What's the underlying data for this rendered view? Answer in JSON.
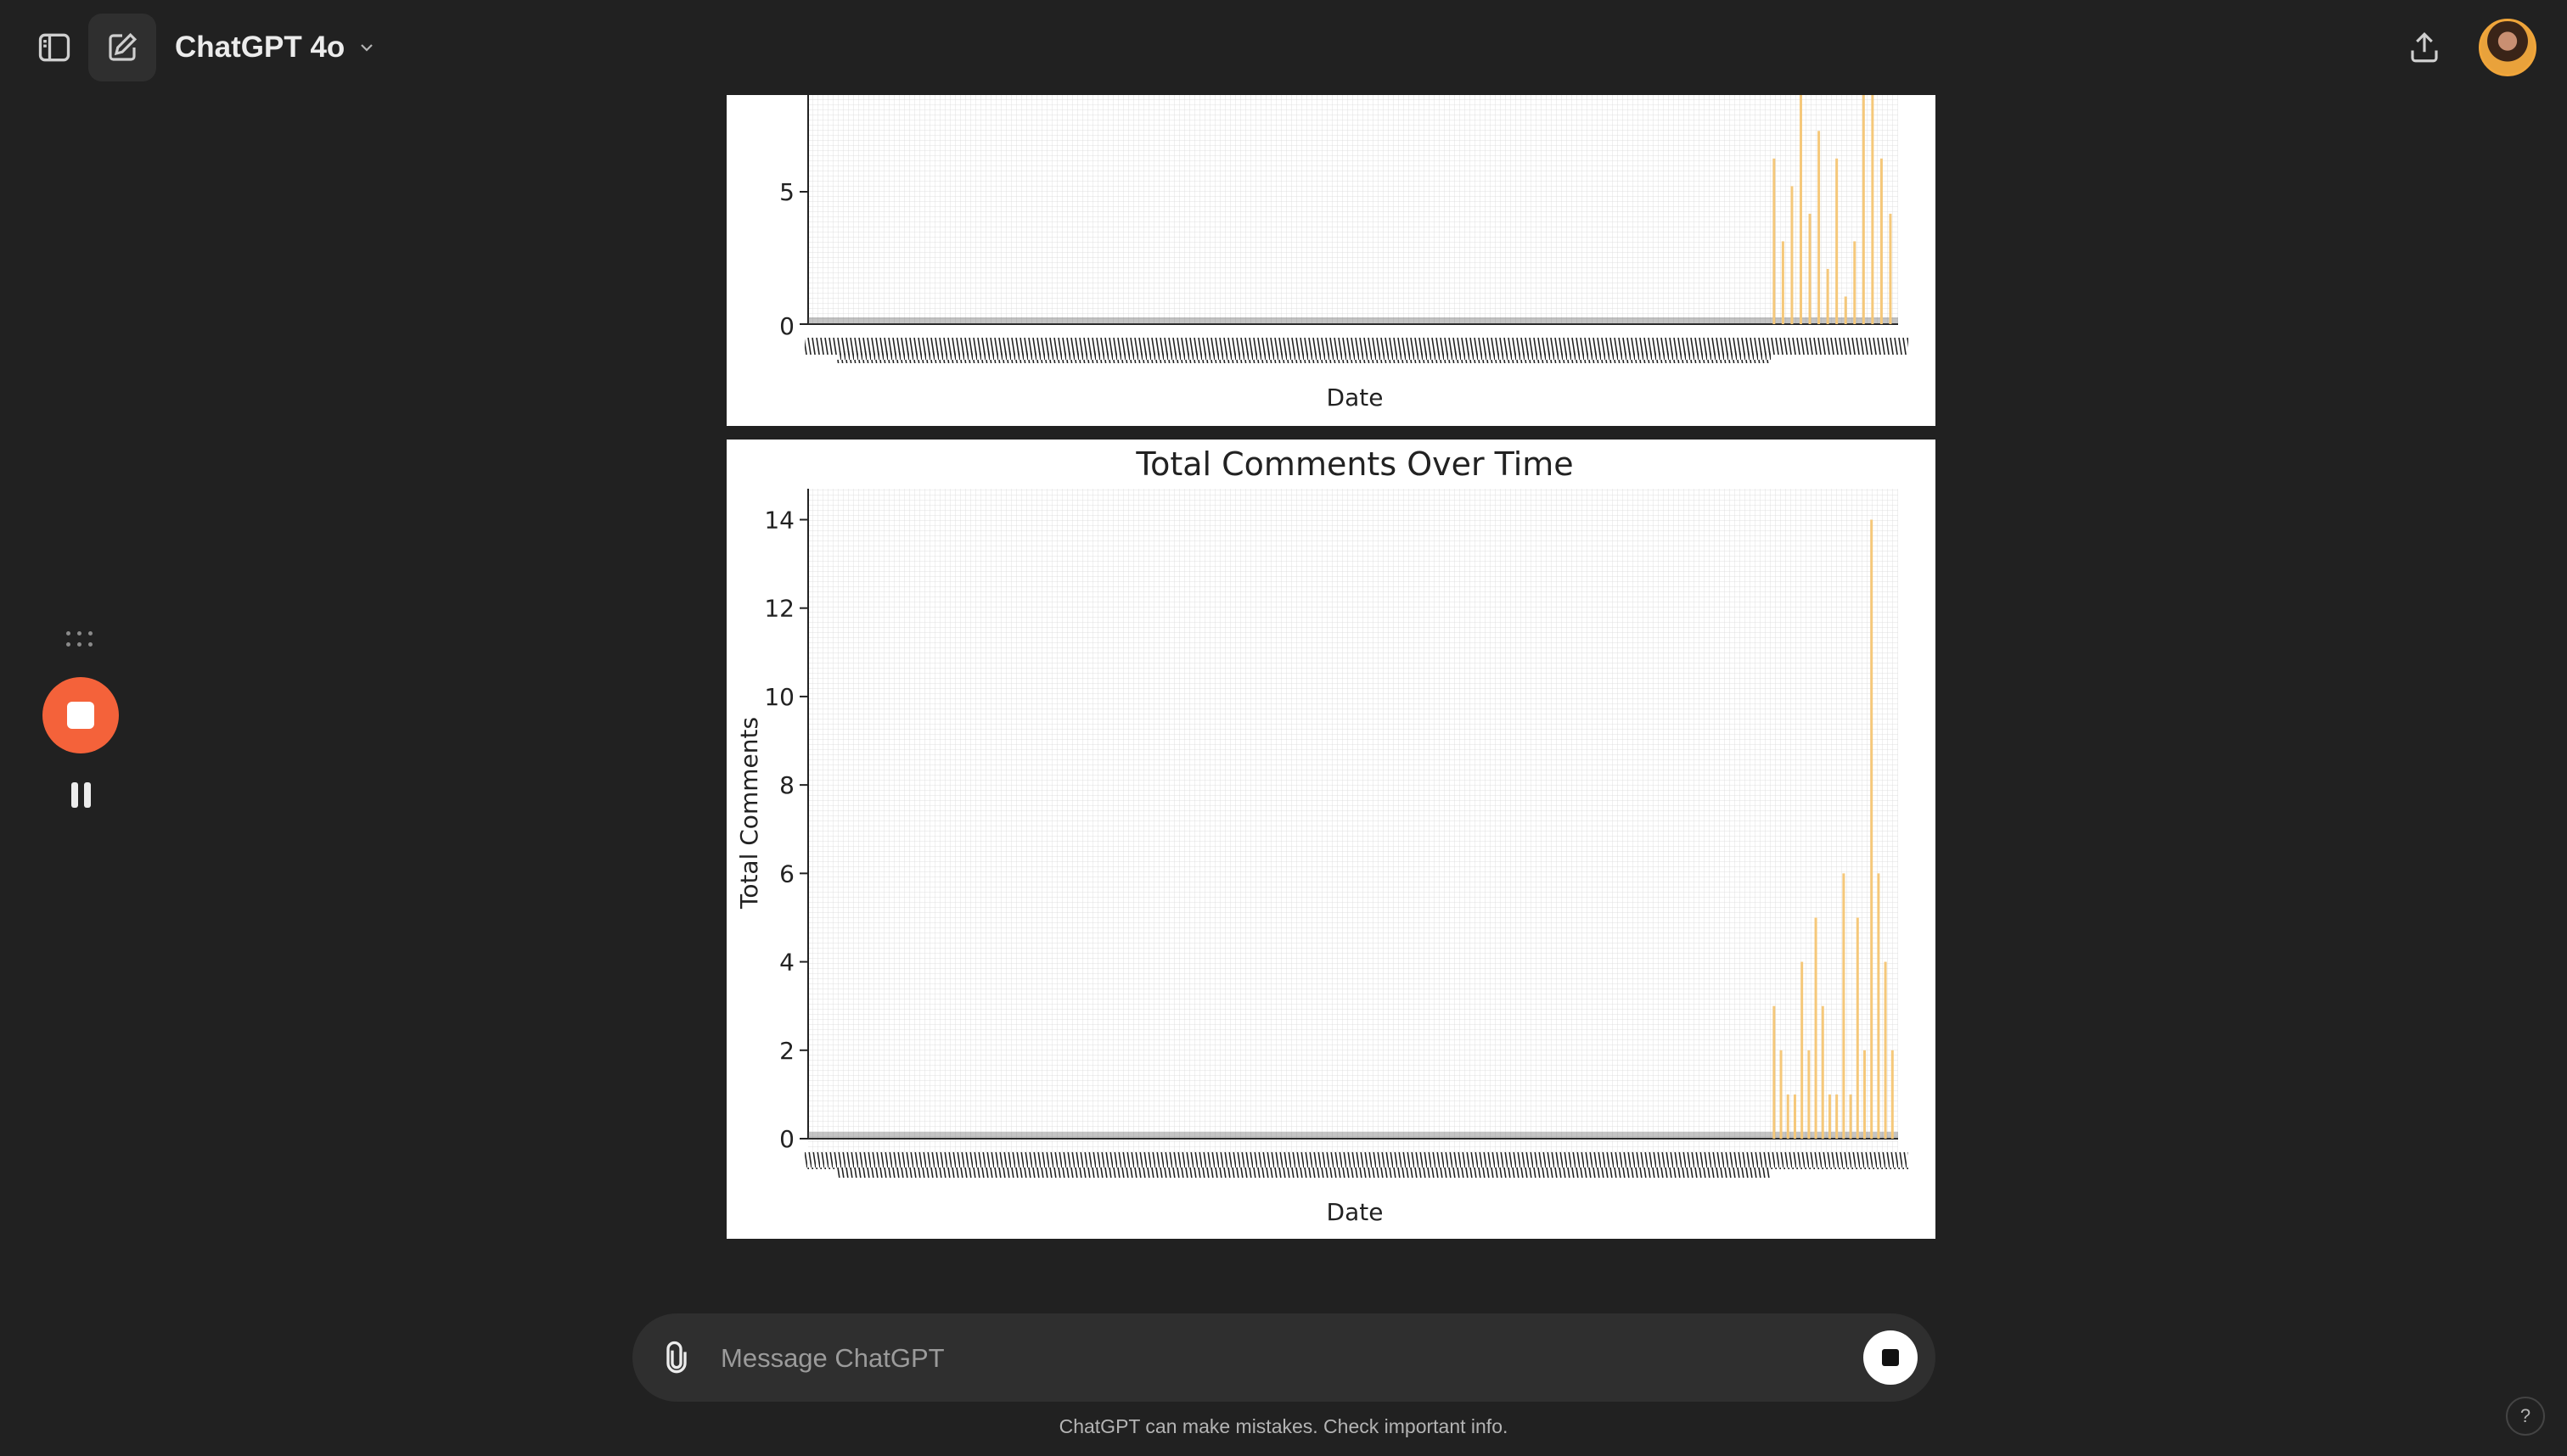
{
  "header": {
    "model_name": "ChatGPT 4o",
    "sidebar_toggle_icon": "sidebar-toggle-icon",
    "new_chat_icon": "compose-icon",
    "dropdown_icon": "chevron-down-icon",
    "share_icon": "share-upload-icon",
    "avatar_icon": "user-avatar"
  },
  "voice_controls": {
    "drag_icon": "grip-dots-icon",
    "stop_icon": "stop-icon",
    "pause_icon": "pause-icon",
    "accent_color": "#f4623a"
  },
  "charts": {
    "bar_color": "#f5c87a",
    "top": {
      "xlabel": "Date",
      "yticks": [
        "5",
        "0"
      ]
    },
    "bottom": {
      "title": "Total Comments Over Time",
      "xlabel": "Date",
      "ylabel": "Total Comments",
      "yticks": [
        "14",
        "12",
        "10",
        "8",
        "6",
        "4",
        "2",
        "0"
      ]
    }
  },
  "chart_data": [
    {
      "type": "bar",
      "partial_view": true,
      "xlabel": "Date",
      "ylabel": "",
      "ylim": [
        0,
        8.3
      ],
      "yticks": [
        0,
        5
      ],
      "grid": true,
      "x": "dense date categories (illegible)",
      "values": [
        6,
        3,
        5,
        8.3,
        4,
        7,
        2,
        6,
        1,
        3,
        8.3,
        8.3,
        6,
        4
      ]
    },
    {
      "type": "bar",
      "title": "Total Comments Over Time",
      "xlabel": "Date",
      "ylabel": "Total Comments",
      "ylim": [
        0,
        14.7
      ],
      "yticks": [
        0,
        2,
        4,
        6,
        8,
        10,
        12,
        14
      ],
      "grid": true,
      "x": "dense date categories (illegible)",
      "values": [
        3,
        2,
        1,
        1,
        4,
        2,
        5,
        3,
        1,
        1,
        6,
        1,
        5,
        2,
        14,
        6,
        4,
        2
      ]
    }
  ],
  "composer": {
    "placeholder": "Message ChatGPT",
    "attach_icon": "paperclip-icon",
    "stop_icon": "stop-generating-icon"
  },
  "footer": {
    "disclaimer": "ChatGPT can make mistakes. Check important info.",
    "help_label": "?"
  }
}
